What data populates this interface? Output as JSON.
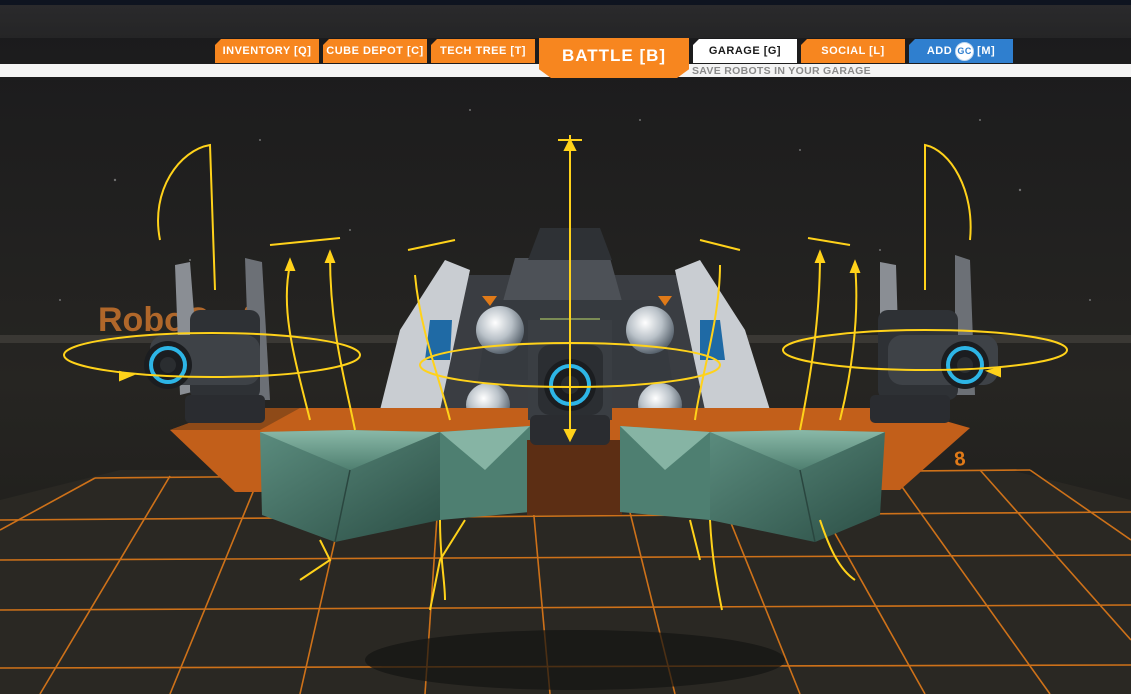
{
  "nav": {
    "tabs": [
      {
        "label": "INVENTORY [Q]"
      },
      {
        "label": "CUBE DEPOT [C]"
      },
      {
        "label": "TECH TREE [T]"
      },
      {
        "label": "BATTLE [B]"
      },
      {
        "label": "GARAGE [G]"
      },
      {
        "label": "SOCIAL [L]"
      },
      {
        "label_pre": "ADD",
        "badge": "GC",
        "label_post": "[M]"
      }
    ],
    "hint": "SAVE ROBOTS IN YOUR GARAGE"
  },
  "scene": {
    "logo_text": "RoboCraft",
    "floor_marker": "8"
  },
  "colors": {
    "accent_orange": "#f7861f",
    "blue_tab": "#2f7fcf",
    "grid_orange": "#e07a18",
    "cube_teal": "#6f9f90",
    "gizmo_yellow": "#ffd21a"
  },
  "icons": [
    "gc-currency-icon"
  ]
}
